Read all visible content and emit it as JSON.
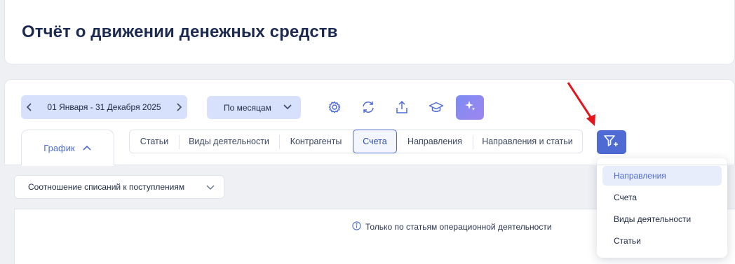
{
  "header": {
    "title": "Отчёт о движении денежных средств"
  },
  "toolbar": {
    "date_range": "01 Января - 31 Декабря 2025",
    "period": "По месяцам",
    "icons": [
      "settings-icon",
      "refresh-icon",
      "upload-icon",
      "graduation-cap-icon",
      "sparkle-icon"
    ]
  },
  "view_tab": {
    "label": "График"
  },
  "segments": [
    {
      "label": "Статьи",
      "active": false
    },
    {
      "label": "Виды деятельности",
      "active": false
    },
    {
      "label": "Контрагенты",
      "active": false
    },
    {
      "label": "Счета",
      "active": true
    },
    {
      "label": "Направления",
      "active": false
    },
    {
      "label": "Направления и статьи",
      "active": false
    }
  ],
  "chart_selector": {
    "value": "Соотношение списаний к поступлениям"
  },
  "chart_note": "Только по статьям операционной деятельности",
  "filter_menu": {
    "items": [
      {
        "label": "Направления",
        "active": true
      },
      {
        "label": "Счета",
        "active": false
      },
      {
        "label": "Виды деятельности",
        "active": false
      },
      {
        "label": "Статьи",
        "active": false
      }
    ]
  },
  "colors": {
    "accent": "#4d6bd3",
    "chip_bg": "#d7e1fb",
    "title": "#1c2b4f",
    "annotation_arrow": "#e3141b"
  }
}
